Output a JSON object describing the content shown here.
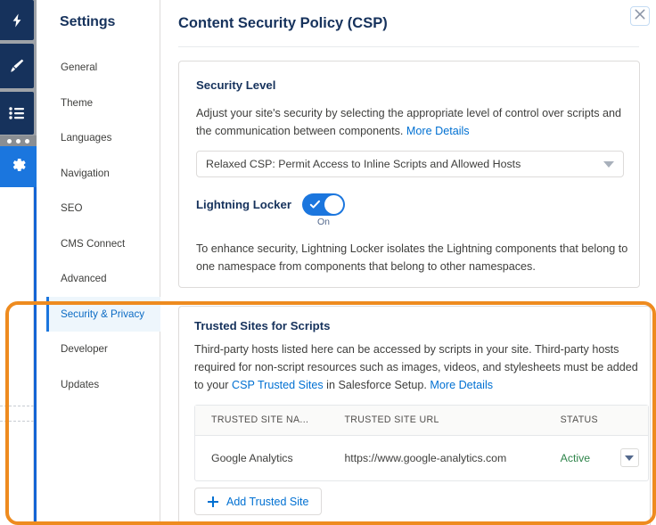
{
  "rail": {
    "buttons": [
      {
        "icon": "lightning-bolt-icon"
      },
      {
        "icon": "paintbrush-icon"
      },
      {
        "icon": "list-icon"
      }
    ],
    "active_button": {
      "icon": "gear-icon"
    }
  },
  "sidebar": {
    "title": "Settings",
    "items": [
      {
        "label": "General",
        "active": false
      },
      {
        "label": "Theme",
        "active": false
      },
      {
        "label": "Languages",
        "active": false
      },
      {
        "label": "Navigation",
        "active": false
      },
      {
        "label": "SEO",
        "active": false
      },
      {
        "label": "CMS Connect",
        "active": false
      },
      {
        "label": "Advanced",
        "active": false
      },
      {
        "label": "Security & Privacy",
        "active": true
      },
      {
        "label": "Developer",
        "active": false
      },
      {
        "label": "Updates",
        "active": false
      }
    ]
  },
  "header": {
    "title": "Content Security Policy (CSP)",
    "close_label": "✕"
  },
  "security_level": {
    "heading": "Security Level",
    "description_part1": "Adjust your site's security by selecting the appropriate level of control over scripts and the communication between components. ",
    "more_details_link": "More Details",
    "select_value": "Relaxed CSP: Permit Access to Inline Scripts and Allowed Hosts"
  },
  "lightning_locker": {
    "label": "Lightning Locker",
    "toggle_state": "On",
    "description": "To enhance security, Lightning Locker isolates the Lightning components that belong to one namespace from components that belong to other namespaces."
  },
  "trusted_sites": {
    "heading": "Trusted Sites for Scripts",
    "description_part1": "Third-party hosts listed here can be accessed by scripts in your site. Third-party hosts required for non-script resources such as images, videos, and stylesheets must be added to your ",
    "csp_link": "CSP Trusted Sites",
    "description_part2": " in Salesforce Setup. ",
    "more_details_link": "More Details",
    "table": {
      "columns": [
        "TRUSTED SITE NA...",
        "TRUSTED SITE URL",
        "STATUS",
        ""
      ],
      "rows": [
        {
          "name": "Google Analytics",
          "url": "https://www.google-analytics.com",
          "status": "Active"
        }
      ]
    },
    "add_button_label": "Add Trusted Site"
  },
  "colors": {
    "brand_blue": "#1b76de",
    "link_blue": "#0070d2",
    "navy": "#16325c",
    "highlight_orange": "#ee8b1f",
    "status_green": "#2e844a"
  }
}
